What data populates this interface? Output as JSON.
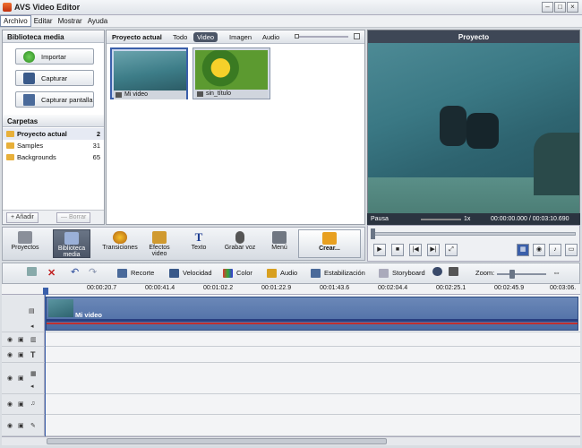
{
  "window": {
    "title": "AVS Video Editor"
  },
  "menu": [
    "Archivo",
    "Editar",
    "Mostrar",
    "Ayuda"
  ],
  "library": {
    "title": "Biblioteca media",
    "buttons": [
      "Importar",
      "Capturar",
      "Capturar pantalla"
    ],
    "folders_title": "Carpetas",
    "folders": [
      {
        "name": "Proyecto actual",
        "count": "2"
      },
      {
        "name": "Samples",
        "count": "31"
      },
      {
        "name": "Backgrounds",
        "count": "65"
      }
    ],
    "add": "+ Añadir",
    "remove": "— Borrar"
  },
  "media": {
    "title": "Proyecto actual",
    "tabs": [
      "Todo",
      "Video",
      "Imagen",
      "Audio"
    ],
    "active_tab": "Video",
    "items": [
      "Mi video",
      "sin_título"
    ]
  },
  "preview": {
    "title": "Proyecto",
    "state": "Pausa",
    "speed": "1x",
    "time": "00:00:00.000 / 00:03:10.690"
  },
  "toolbar": [
    "Proyectos",
    "Biblioteca media",
    "Transiciones",
    "Efectos video",
    "Texto",
    "Grabar voz",
    "Menú",
    "Crear..."
  ],
  "edit_toolbar": {
    "recorte": "Recorte",
    "velocidad": "Velocidad",
    "color": "Color",
    "audio": "Audio",
    "estabilizacion": "Estabilización",
    "storyboard": "Storyboard",
    "zoom": "Zoom:"
  },
  "ruler": [
    "00:00:20.7",
    "00:00:41.4",
    "00:01:02.2",
    "00:01:22.9",
    "00:01:43.6",
    "00:02:04.4",
    "00:02:25.1",
    "00:02:45.9",
    "00:03:06."
  ],
  "timeline": {
    "clip": "Mi video"
  }
}
